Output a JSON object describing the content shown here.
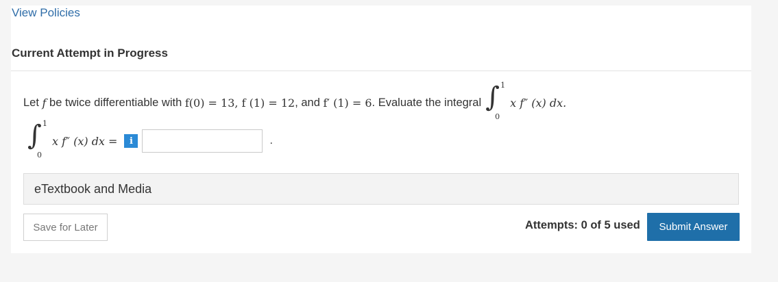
{
  "links": {
    "view_policies": "View Policies"
  },
  "section": {
    "title": "Current Attempt in Progress"
  },
  "question": {
    "lead": "Let",
    "var_f": "f",
    "be_text": "be twice differentiable with",
    "cond1": "f(0) = 13",
    "cond2": "f (1) = 12",
    "and_text": ", and",
    "cond3": "f′ (1) = 6",
    "tail": ". Evaluate the integral",
    "integral_upper": "1",
    "integral_lower": "0",
    "integrand": "x f″ (x) dx."
  },
  "answer": {
    "integral_upper": "1",
    "integral_lower": "0",
    "expr": "x f″ (x) dx =",
    "info_icon": "i",
    "input_value": "",
    "input_placeholder": "",
    "trailing": "."
  },
  "etextbook": {
    "label": "eTextbook and Media"
  },
  "footer": {
    "save_label": "Save for Later",
    "attempts_text": "Attempts: 0 of 5 used",
    "submit_label": "Submit Answer"
  },
  "colors": {
    "link": "#2f6da8",
    "submit_bg": "#1f6fa9",
    "info_bg": "#2b8ad6"
  }
}
